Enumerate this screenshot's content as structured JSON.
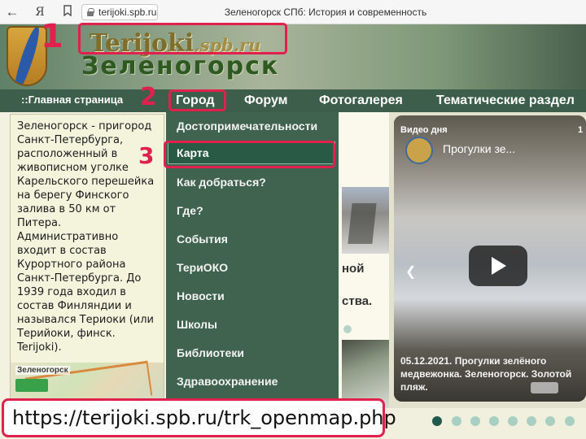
{
  "browser": {
    "url": "terijoki.spb.ru",
    "tab_title": "Зеленогорск СПб: История и современность",
    "back_icon": "←",
    "yandex_icon": "Я"
  },
  "header": {
    "logo_main": "Terijoki",
    "logo_suffix": ".spb.ru",
    "city": "Зеленогорск"
  },
  "nav": {
    "home": "::Главная страница",
    "city": "Город",
    "forum": "Форум",
    "gallery": "Фотогалерея",
    "topics": "Тематические раздел"
  },
  "description": "Зеленогорск - пригород Санкт-Петербурга, расположенный в живописном уголке Карельского перешейка на берегу Финского залива в 50 км от Питера. Административно входит в состав Курортного района Санкт-Петербурга. До 1939 года входил в состав Финляндии и назывался Териоки (или Терийоки, финск. Terijoki).",
  "map_label": "Зеленогорск",
  "dropdown": {
    "items": [
      "Достопримечательности",
      "Карта",
      "Как добраться?",
      "Где?",
      "События",
      "ТериОКО",
      "Новости",
      "Школы",
      "Библиотеки",
      "Здравоохранение"
    ],
    "active_index": 1
  },
  "middle": {
    "text1": "ной",
    "text2": "ства."
  },
  "video": {
    "label": "Видео дня",
    "title": "Прогулки зе...",
    "count": "1",
    "caption": "05.12.2021. Прогулки зелёного медвежонка. Зеленогорск. Золотой пляж."
  },
  "overlay_url": "https://terijoki.spb.ru/trk_openmap.php",
  "annotations": [
    "1",
    "2",
    "3"
  ],
  "colors": {
    "annotation": "#e0214d",
    "nav_bg": "#3c5e4a",
    "dropdown_bg": "#3f634f",
    "active_item_bg": "#295a45"
  }
}
